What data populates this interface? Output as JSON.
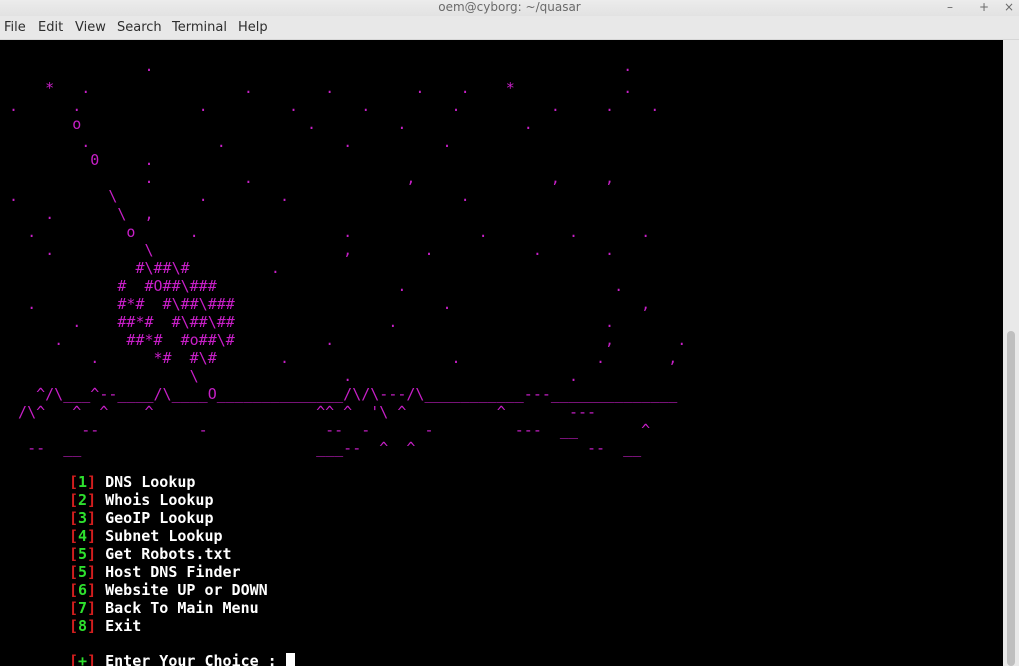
{
  "window": {
    "title": "oem@cyborg: ~/quasar",
    "minimize": "–",
    "maximize": "+",
    "close": "×"
  },
  "menubar": [
    "File",
    "Edit",
    "View",
    "Search",
    "Terminal",
    "Help"
  ],
  "banner": [
    "                ·                                                    ·",
    "     *   .                 .        .         .    .    *            .",
    " .      .             .         .       .         .          .     .    .",
    "        o                         .         .             .",
    "         .              .             .          .",
    "          0     .",
    "                .          .                 ,               ,     ,",
    " .          \\         .        .                   .",
    "     .       \\  ,",
    "   .          o      .                .              .         .       .",
    "     .          \\                     ,        .           .       .",
    "               #\\##\\#         .",
    "             #  #O##\\###                    .                       .",
    "   .         #*#  #\\##\\###                       .                     ,",
    "        .    ##*#  #\\##\\##                 .                       .",
    "      .       ##*#  #o##\\#          .                              ,       .",
    "          .      *#  #\\#       .                  .               .       ,",
    "                     \\                .                        .",
    "    ^/\\___^--____/\\____O______________/\\/\\---/\\___________---______________",
    "  /\\^   ^  ^    ^                  ^^ ^  '\\ ^          ^       ---",
    "         --           -             --  -      -         ---  __       ^",
    "   --  __                          ___--  ^  ^                   --  __"
  ],
  "menu": {
    "items": [
      {
        "num": "1",
        "label": "DNS Lookup"
      },
      {
        "num": "2",
        "label": "Whois Lookup"
      },
      {
        "num": "3",
        "label": "GeoIP Lookup"
      },
      {
        "num": "4",
        "label": "Subnet Lookup"
      },
      {
        "num": "5",
        "label": "Get Robots.txt"
      },
      {
        "num": "5",
        "label": "Host DNS Finder"
      },
      {
        "num": "6",
        "label": "Website UP or DOWN"
      },
      {
        "num": "7",
        "label": "Back To Main Menu"
      },
      {
        "num": "8",
        "label": "Exit"
      }
    ],
    "prompt_marker": "+",
    "prompt": " Enter Your Choice : "
  },
  "colors": {
    "banner": "#c81fc8",
    "bracket": "#d21e1e",
    "number": "#2ee02e",
    "text": "#ffffff",
    "background": "#000000"
  }
}
